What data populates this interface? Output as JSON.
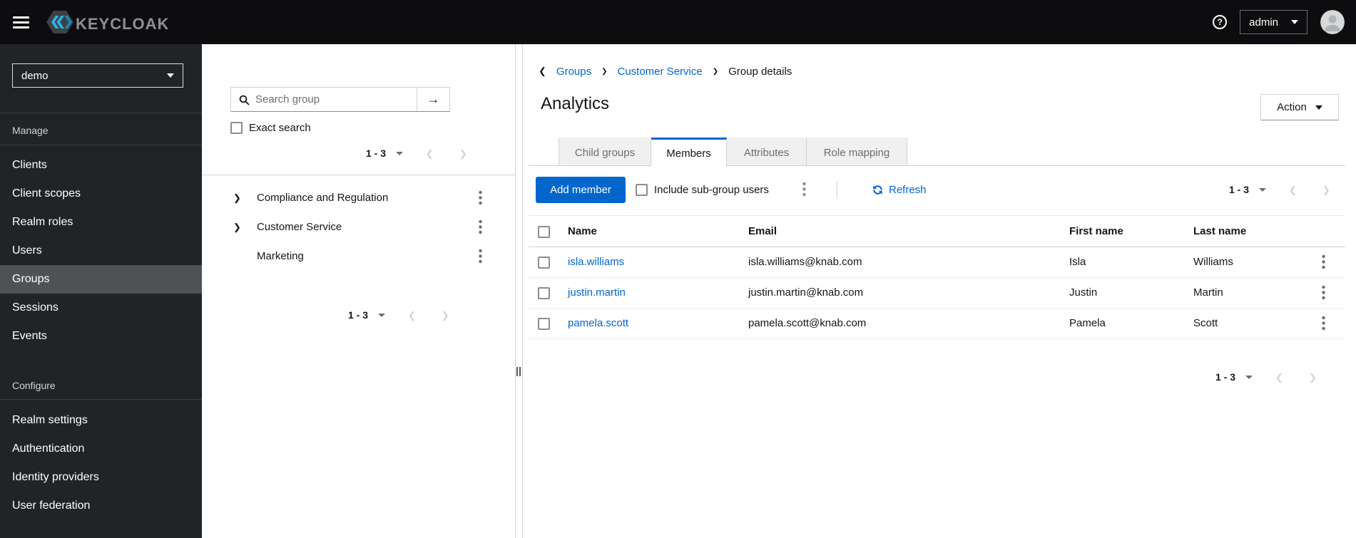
{
  "colors": {
    "accent": "#0066cc",
    "link": "#0066cc",
    "masthead_bg": "#0d0d0f",
    "nav_bg": "#212427",
    "nav_selected_bg": "#4f5255",
    "tab_inactive_bg": "#f0f0f0",
    "muted_text": "#6a6e73"
  },
  "masthead": {
    "brand": "KEYCLOAK",
    "user": "admin"
  },
  "sidebar": {
    "realm": "demo",
    "manage": {
      "label": "Manage",
      "items": [
        "Clients",
        "Client scopes",
        "Realm roles",
        "Users",
        "Groups",
        "Sessions",
        "Events"
      ],
      "active_item": "Groups"
    },
    "configure": {
      "label": "Configure",
      "items": [
        "Realm settings",
        "Authentication",
        "Identity providers",
        "User federation"
      ]
    }
  },
  "tree": {
    "search_placeholder": "Search group",
    "exact_search_label": "Exact search",
    "top_range": "1 - 3",
    "bottom_range": "1 - 3",
    "groups": [
      "Compliance and Regulation",
      "Customer Service",
      "Marketing"
    ]
  },
  "main": {
    "breadcrumb": {
      "items": [
        "Groups",
        "Customer Service",
        "Group details"
      ]
    },
    "title": "Analytics",
    "action_label": "Action",
    "tabs": [
      "Child groups",
      "Members",
      "Attributes",
      "Role mapping"
    ],
    "active_tab": "Members",
    "toolbar": {
      "add_member_label": "Add member",
      "include_subgroups_label": "Include sub-group users",
      "refresh_label": "Refresh",
      "range": "1 - 3"
    },
    "table": {
      "headers": [
        "Name",
        "Email",
        "First name",
        "Last name"
      ],
      "rows": [
        {
          "name": "isla.williams",
          "email": "isla.williams@knab.com",
          "first_name": "Isla",
          "last_name": "Williams"
        },
        {
          "name": "justin.martin",
          "email": "justin.martin@knab.com",
          "first_name": "Justin",
          "last_name": "Martin"
        },
        {
          "name": "pamela.scott",
          "email": "pamela.scott@knab.com",
          "first_name": "Pamela",
          "last_name": "Scott"
        }
      ]
    },
    "bottom_range": "1 - 3"
  }
}
